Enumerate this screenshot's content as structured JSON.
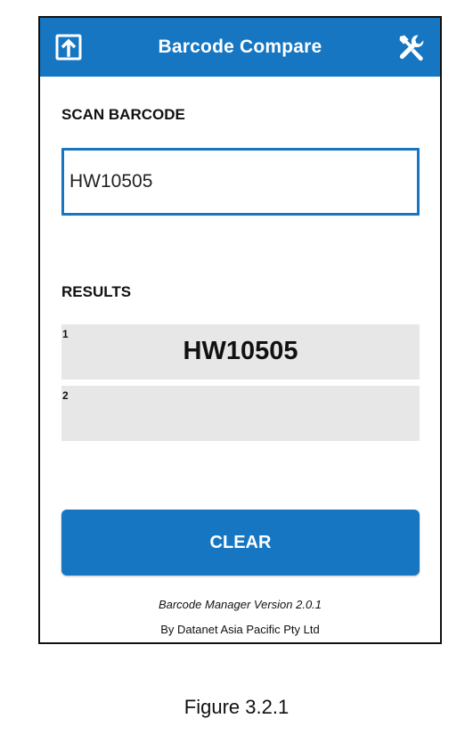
{
  "app": {
    "title": "Barcode Compare",
    "accent_color": "#1676c2",
    "left_icon": "export-icon",
    "right_icon": "wrench-icon"
  },
  "scan": {
    "label": "SCAN BARCODE",
    "input_value": "HW10505"
  },
  "results": {
    "label": "RESULTS",
    "rows": [
      {
        "index": "1",
        "value": "HW10505"
      },
      {
        "index": "2",
        "value": ""
      }
    ]
  },
  "actions": {
    "clear_label": "CLEAR"
  },
  "footer": {
    "version": "Barcode Manager Version 2.0.1",
    "company": "By Datanet Asia Pacific Pty Ltd"
  },
  "caption": "Figure 3.2.1"
}
